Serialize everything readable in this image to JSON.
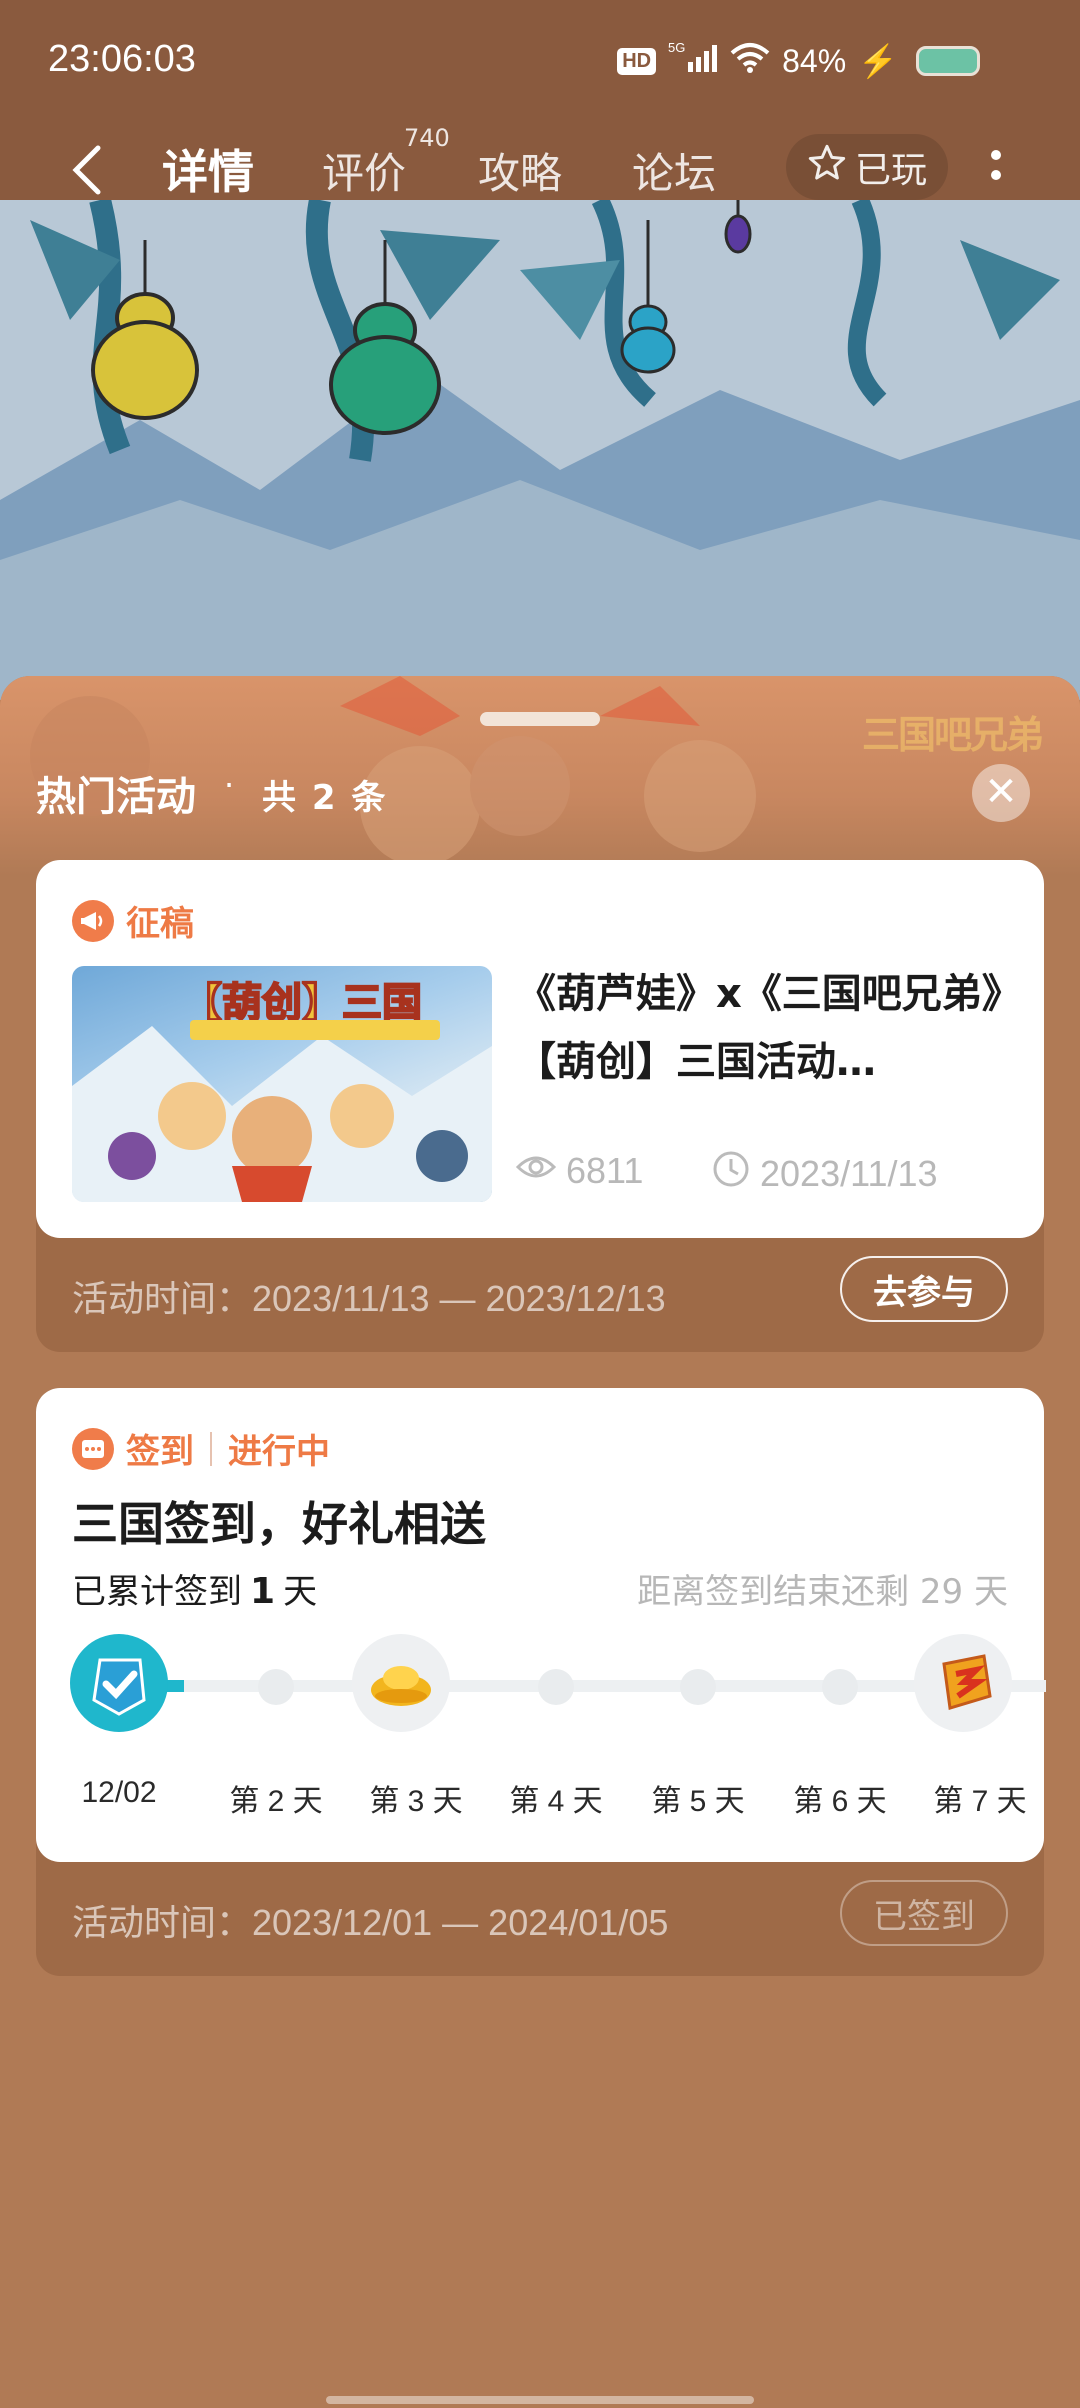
{
  "status_bar": {
    "time": "23:06:03",
    "network": "5G",
    "hd": "HD",
    "battery": "84%"
  },
  "nav": {
    "tabs": [
      {
        "label": "详情",
        "active": true
      },
      {
        "label": "评价",
        "active": false
      },
      {
        "label": "攻略",
        "active": false
      },
      {
        "label": "论坛",
        "active": false
      }
    ],
    "review_count": "740",
    "played_label": "已玩"
  },
  "sheet": {
    "title": "热门活动",
    "dot": "·",
    "count_text": "共 2 条",
    "brand": "三国吧兄弟"
  },
  "activity1": {
    "tag": "征稿",
    "thumb_title": "【葫创】三国",
    "headline": "《葫芦娃》x《三国吧兄弟》【葫创】三国活动…",
    "views": "6811",
    "date": "2023/11/13",
    "time_text": "活动时间：2023/11/13 — 2023/12/13",
    "button": "去参与"
  },
  "activity2": {
    "tag": "签到",
    "status": "进行中",
    "title": "三国签到，好礼相送",
    "acc_prefix": "已累计签到",
    "acc_days": "1",
    "acc_suffix": "天",
    "remain": "距离签到结束还剩 29 天",
    "days": [
      "12/02",
      "第 2 天",
      "第 3 天",
      "第 4 天",
      "第 5 天",
      "第 6 天",
      "第 7 天"
    ],
    "time_text": "活动时间：2023/12/01 — 2024/01/05",
    "button": "已签到"
  },
  "colors": {
    "accent": "#ee7a45",
    "checkin": "#1fb7cc",
    "sheet": "#b07a55"
  }
}
